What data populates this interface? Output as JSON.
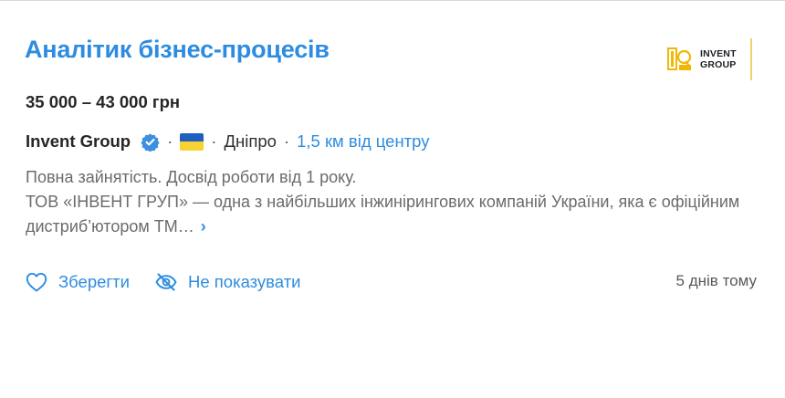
{
  "job": {
    "title": "Аналітик бізнес-процесів",
    "salary": "35 000 – 43 000 грн",
    "company": "Invent Group",
    "city": "Дніпро",
    "distance": "1,5 км від центру",
    "separator": "·",
    "description_line1": "Повна зайнятість. Досвід роботи від 1 року.",
    "description_line2": "ТОВ «ІНВЕНТ ГРУП» — одна з найбільших інжинірингових компаній України, яка є офіційним дистриб’ютором ТМ…",
    "more_glyph": "›",
    "posted": "5 днів тому"
  },
  "logo": {
    "line1": "INVENT",
    "line2": "GROUP",
    "accent_color": "#f2b705"
  },
  "actions": {
    "save_label": "Зберегти",
    "hide_label": "Не показувати"
  },
  "colors": {
    "link": "#2e8ce0",
    "flag_blue": "#1f5fbf",
    "flag_yellow": "#f7d232",
    "verified": "#3d8fe0"
  },
  "icons": {
    "verified": "verified-check-icon",
    "save": "heart-icon",
    "hide": "eye-off-icon",
    "more": "chevron-right-icon"
  }
}
